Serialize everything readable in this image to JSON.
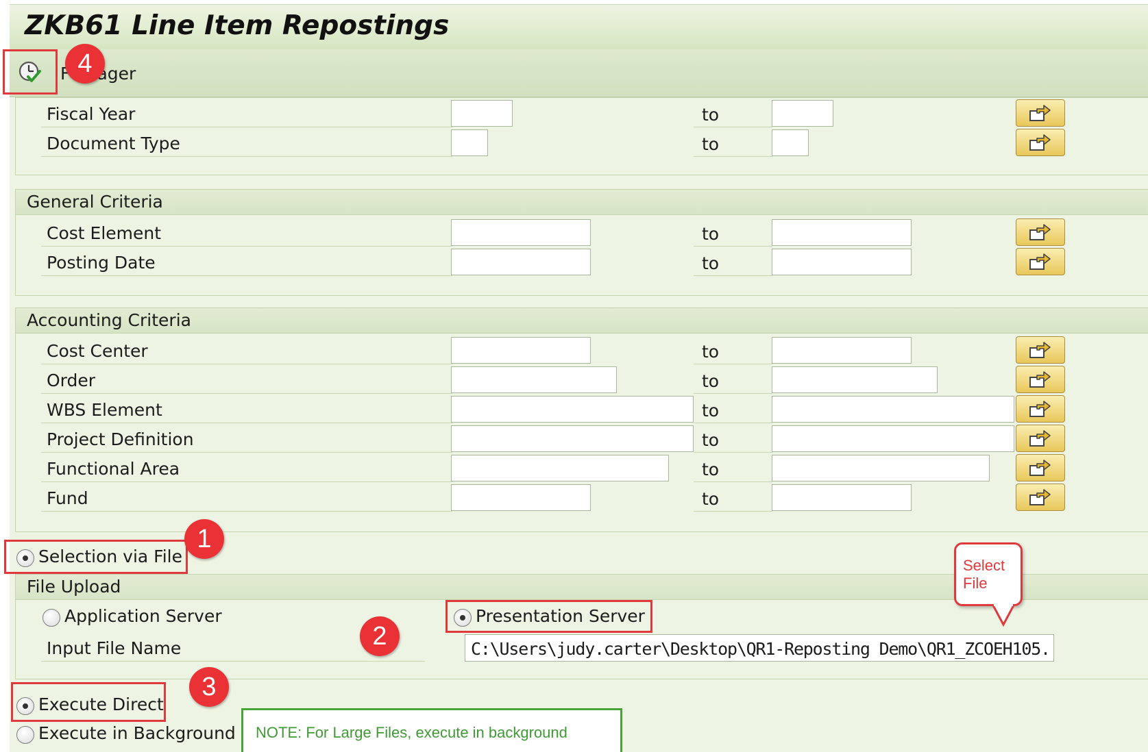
{
  "window": {
    "title": "ZKB61 Line Item Repostings"
  },
  "toolbar": {
    "execute_icon": "execute-clock-check-icon",
    "variant_label": "F  anager"
  },
  "basic_group": {
    "rows": [
      {
        "label": "Fiscal Year",
        "to": "to",
        "from_value": "",
        "to_value": ""
      },
      {
        "label": "Document Type",
        "to": "to",
        "from_value": "",
        "to_value": ""
      }
    ]
  },
  "general_group": {
    "title": "General Criteria",
    "rows": [
      {
        "label": "Cost Element",
        "to": "to",
        "from_value": "",
        "to_value": ""
      },
      {
        "label": "Posting Date",
        "to": "to",
        "from_value": "",
        "to_value": ""
      }
    ]
  },
  "accounting_group": {
    "title": "Accounting Criteria",
    "rows": [
      {
        "label": "Cost Center",
        "to": "to"
      },
      {
        "label": "Order",
        "to": "to"
      },
      {
        "label": "WBS Element",
        "to": "to"
      },
      {
        "label": "Project Definition",
        "to": "to"
      },
      {
        "label": "Functional Area",
        "to": "to"
      },
      {
        "label": "Fund",
        "to": "to"
      }
    ]
  },
  "selection_via_file": {
    "label": "Selection via File",
    "selected": true
  },
  "file_upload": {
    "title": "File Upload",
    "application_server": {
      "label": "Application Server",
      "selected": false
    },
    "presentation_server": {
      "label": "Presentation Server",
      "selected": true
    },
    "input_file_label": "Input File Name",
    "input_file_value": "C:\\Users\\judy.carter\\Desktop\\QR1-Reposting Demo\\QR1_ZCOEH105..."
  },
  "execution": {
    "direct": {
      "label": "Execute Direct",
      "selected": true
    },
    "background": {
      "label": "Execute in Background",
      "selected": false
    }
  },
  "annotations": {
    "step1": "1",
    "step2": "2",
    "step3": "3",
    "step4": "4",
    "callout": "Select File",
    "note": "NOTE:  For Large Files, execute in background"
  },
  "colors": {
    "highlight": "#e0393b",
    "note_border": "#4aa339",
    "header_green": "#d6e6c1",
    "button_yellow": "#e8c85a"
  }
}
